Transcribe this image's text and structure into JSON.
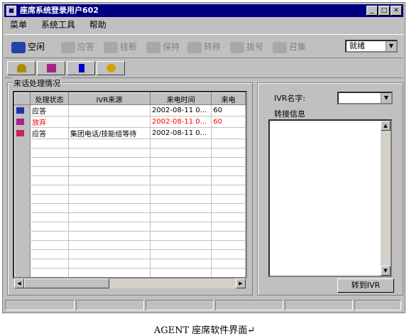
{
  "window": {
    "title": "座席系统登录用户602"
  },
  "menu": [
    "菜单",
    "系统工具",
    "帮助"
  ],
  "toolbar": {
    "tools": [
      {
        "label": "空闲",
        "icon": "phone-idle-icon",
        "enabled": true
      },
      {
        "label": "应答",
        "icon": "phone-answer-icon",
        "enabled": false
      },
      {
        "label": "挂断",
        "icon": "phone-hangup-icon",
        "enabled": false
      },
      {
        "label": "保持",
        "icon": "phone-hold-icon",
        "enabled": false
      },
      {
        "label": "转移",
        "icon": "phone-transfer-icon",
        "enabled": false
      },
      {
        "label": "拨号",
        "icon": "phone-dial-icon",
        "enabled": false
      },
      {
        "label": "召集",
        "icon": "conference-icon",
        "enabled": false
      }
    ],
    "status_value": "就绪"
  },
  "toolbar2": {
    "icons": [
      "key-icon",
      "book-icon",
      "blue-square-icon",
      "gear-icon"
    ]
  },
  "calls": {
    "group_title": "来话处理情况",
    "columns": [
      "处理状态",
      "IVR来源",
      "来电时间",
      "来电"
    ],
    "rows": [
      {
        "status": "应答",
        "source": "",
        "time": "2002-08-11 0...",
        "extra": "60",
        "red": false
      },
      {
        "status": "放弃",
        "source": "",
        "time": "2002-08-11 0...",
        "extra": "60",
        "red": true
      },
      {
        "status": "应答",
        "source": "集团电话/技能组等待",
        "time": "2002-08-11 0...",
        "extra": "",
        "red": false
      }
    ]
  },
  "ivr": {
    "name_label": "IVR名字:",
    "info_label": "转接信息",
    "transfer_button": "转到IVR"
  },
  "caption": "AGENT 座席软件界面↵"
}
